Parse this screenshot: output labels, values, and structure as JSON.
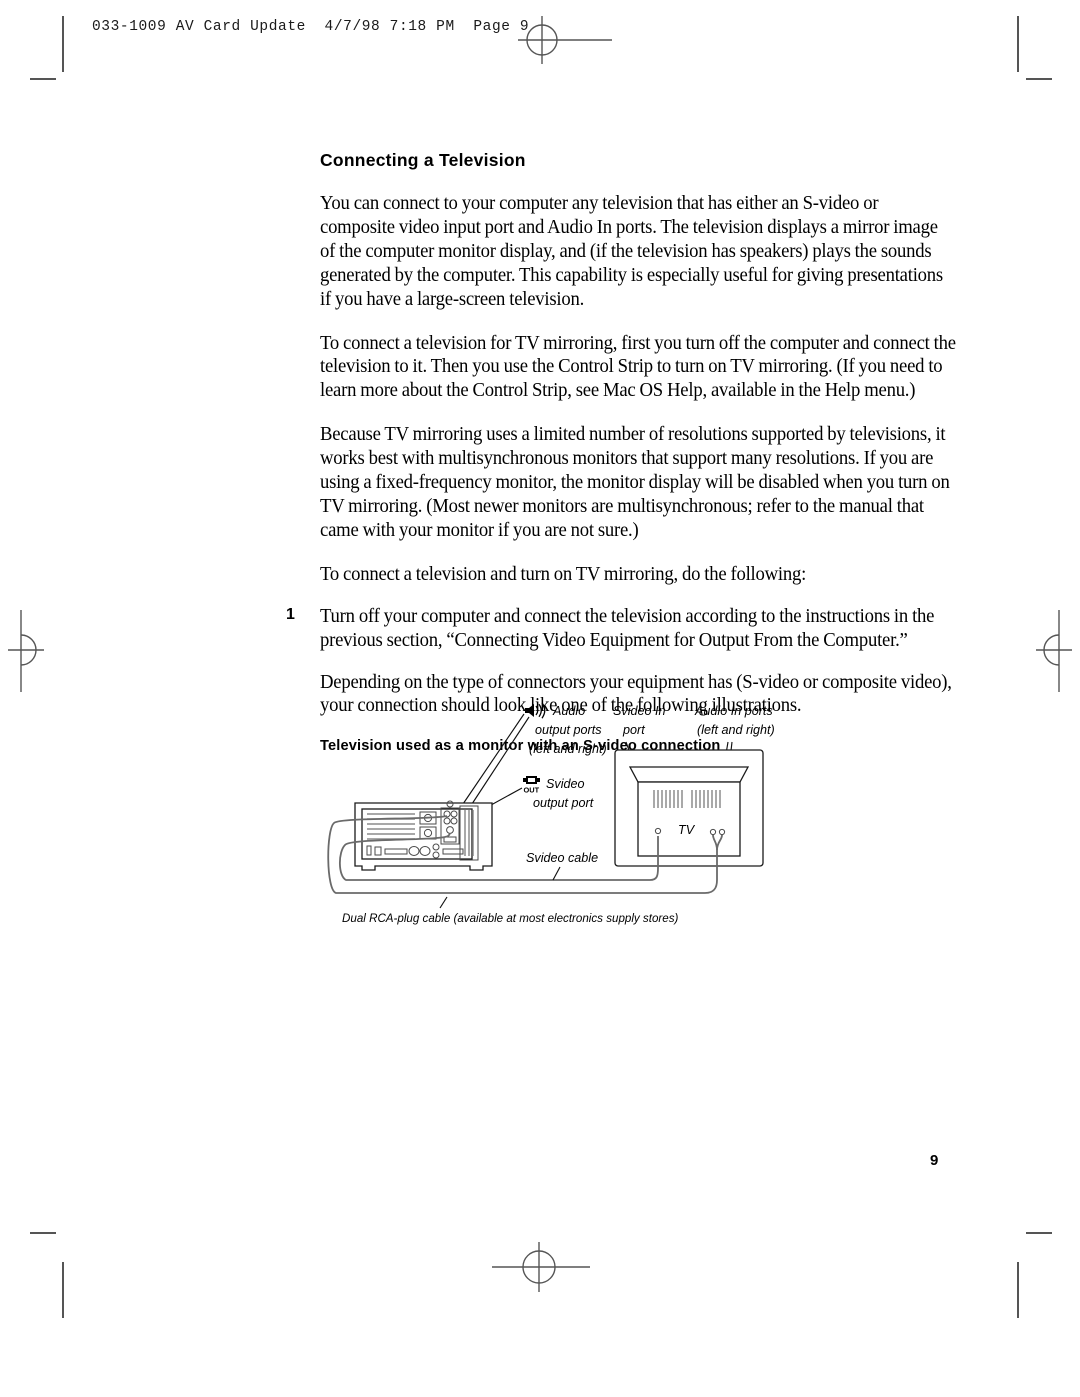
{
  "header": {
    "slug": "033-1009 AV Card Update  4/7/98 7:18 PM  Page 9"
  },
  "content": {
    "section_title": "Connecting a Television",
    "paragraphs": [
      "You can connect to your computer any television that has either an S-video or composite video input port and Audio In ports. The television displays a mirror image of the computer monitor display, and (if the television has speakers) plays the sounds generated by the computer. This capability is especially useful for giving presentations if you have a large-screen television.",
      "To connect a television for TV mirroring, first you turn off the computer and connect the television to it. Then you use the Control Strip to turn on TV mirroring. (If you need to learn more about the Control Strip, see Mac OS Help, available in the Help menu.)",
      "Because TV mirroring uses a limited number of resolutions supported by televisions, it works best with multisynchronous monitors that support many resolutions. If you are using a fixed-frequency monitor, the monitor display will be disabled when you turn on TV mirroring. (Most newer monitors are multisynchronous; refer to the manual that came with your monitor if you are not sure.)",
      "To connect a television and turn on TV mirroring, do the following:"
    ],
    "step": {
      "number": "1",
      "text": "Turn off your computer and connect the television according to the instructions in the previous section, “Connecting Video Equipment for Output From the Computer.”"
    },
    "after_step_paragraph": "Depending on the type of connectors your equipment has (S-video or composite video), your connection should look like one of the following illustrations.",
    "figure_title": "Television used as a monitor with an S-video connection"
  },
  "figure": {
    "labels": {
      "audio_output": [
        "Audio",
        "output ports",
        "(left and right)"
      ],
      "svideo_output": [
        "Svideo",
        "output port"
      ],
      "svideo_in": [
        "Svideo In",
        "port"
      ],
      "audio_in": [
        "Audio In ports",
        "(left and right)"
      ],
      "svideo_cable": "Svideo cable",
      "tv": "TV",
      "out_badge": "OUT"
    },
    "caption": "Dual RCA-plug cable (available at most electronics supply stores)",
    "icons": {
      "speaker": "speaker-icon",
      "video_out": "video-out-icon"
    },
    "colors": {
      "outline": "#1a1a1a",
      "cable": "#5a5a5a",
      "vent": "#8c8c8c",
      "panel_fill": "#ffffff"
    }
  },
  "page_number": "9"
}
